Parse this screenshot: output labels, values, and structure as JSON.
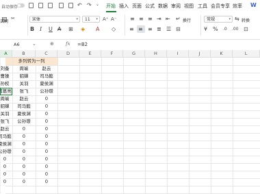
{
  "menubar": {
    "autosave_label": "自动保存",
    "tabs": [
      "开始",
      "插入",
      "页面",
      "公式",
      "数据",
      "审阅",
      "视图",
      "工具",
      "会员专享",
      "效率"
    ],
    "active_tab": "开始",
    "ai_label": "W"
  },
  "toolbar": {
    "format_painter_label": "式刷",
    "font_name": "宋体",
    "font_size": "11",
    "wrap_label": "换行",
    "number_format": "常规",
    "convert_label": "转换"
  },
  "formula_bar": {
    "name_box": "A6",
    "formula": "=B2"
  },
  "columns": [
    "A",
    "B",
    "C",
    "D",
    "E",
    "F",
    "G",
    "H",
    "I",
    "J",
    "K",
    "L"
  ],
  "merged_title": "多列转为一列",
  "rows": [
    [
      "刘备",
      "周瑜",
      "赵云"
    ],
    [
      "曹操",
      "貂蝉",
      "司马懿"
    ],
    [
      "孙权",
      "关羽",
      "夏侯渊"
    ],
    [
      "诸葛亮",
      "张飞",
      "公孙瓒"
    ],
    [
      "周瑜",
      "赵云",
      "0"
    ],
    [
      "貂蝉",
      "司马懿",
      "0"
    ],
    [
      "关羽",
      "夏侯渊",
      "0"
    ],
    [
      "张飞",
      "公孙瓒",
      "0"
    ],
    [
      "赵云",
      "0",
      "0"
    ],
    [
      "司马懿",
      "0",
      "0"
    ],
    [
      "夏侯渊",
      "0",
      "0"
    ],
    [
      "公孙瓒",
      "0",
      "0"
    ],
    [
      "0",
      "0",
      "0"
    ],
    [
      "0",
      "0",
      "0"
    ],
    [
      "0",
      "0",
      "0"
    ],
    [
      "0",
      "0",
      "0"
    ]
  ]
}
